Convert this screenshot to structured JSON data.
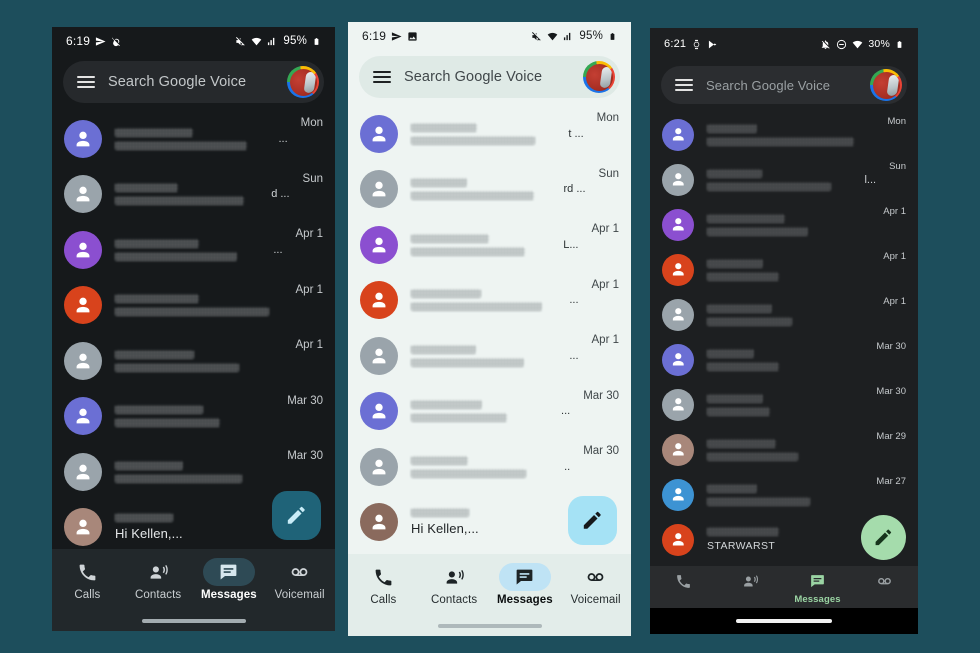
{
  "page": {
    "background_color": "#1d4e5c"
  },
  "phones": [
    {
      "id": "dark1",
      "theme": "dark",
      "status": {
        "time": "6:19",
        "battery": "95%",
        "left_icons": [
          "send-icon",
          "vibrate-off-icon"
        ],
        "right_icons": [
          "mute-icon",
          "wifi-icon",
          "signal-icon"
        ]
      },
      "search": {
        "placeholder": "Search Google Voice",
        "menu_icon": "hamburger-icon",
        "account_icon": "account-avatar-icon"
      },
      "fab": {
        "icon": "compose-pencil-icon",
        "color": "#1f6378"
      },
      "rows": [
        {
          "time": "Mon",
          "avatar_color": "#6b6fd4",
          "title_w": 52,
          "sub_w": 88,
          "tail": "..."
        },
        {
          "time": "Sun",
          "avatar_color": "#9aa4ab",
          "title_w": 44,
          "sub_w": 90,
          "tail": "d ..."
        },
        {
          "time": "Apr 1",
          "avatar_color": "#8b4fd0",
          "title_w": 58,
          "sub_w": 84,
          "tail": "..."
        },
        {
          "time": "Apr 1",
          "avatar_color": "#d8431c",
          "title_w": 50,
          "sub_w": 92,
          "tail": ""
        },
        {
          "time": "Apr 1",
          "avatar_color": "#9aa4ab",
          "title_w": 47,
          "sub_w": 74,
          "tail": ""
        },
        {
          "time": "Mar 30",
          "avatar_color": "#6b6fd4",
          "title_w": 55,
          "sub_w": 66,
          "tail": ""
        },
        {
          "time": "Mar 30",
          "avatar_color": "#9aa4ab",
          "title_w": 43,
          "sub_w": 80,
          "tail": ""
        },
        {
          "time": "",
          "avatar_color": "#a8877a",
          "title_w": 28,
          "sub_text": "Hi Kellen,...",
          "tail": ""
        }
      ],
      "nav": [
        {
          "label": "Calls",
          "icon": "phone-icon",
          "active": false
        },
        {
          "label": "Contacts",
          "icon": "contacts-icon",
          "active": false
        },
        {
          "label": "Messages",
          "icon": "messages-icon",
          "active": true
        },
        {
          "label": "Voicemail",
          "icon": "voicemail-icon",
          "active": false
        }
      ]
    },
    {
      "id": "light",
      "theme": "light",
      "status": {
        "time": "6:19",
        "battery": "95%",
        "left_icons": [
          "send-icon",
          "photo-icon"
        ],
        "right_icons": [
          "mute-icon",
          "wifi-icon",
          "signal-icon"
        ]
      },
      "search": {
        "placeholder": "Search Google Voice",
        "menu_icon": "hamburger-icon",
        "account_icon": "account-avatar-icon"
      },
      "fab": {
        "icon": "compose-pencil-icon",
        "color": "#a5e2f5"
      },
      "rows": [
        {
          "time": "Mon",
          "avatar_color": "#6b6fd4",
          "title_w": 46,
          "sub_w": 86,
          "tail": "t ..."
        },
        {
          "time": "Sun",
          "avatar_color": "#9aa4ab",
          "title_w": 40,
          "sub_w": 88,
          "tail": "rd ..."
        },
        {
          "time": "Apr 1",
          "avatar_color": "#8b4fd0",
          "title_w": 56,
          "sub_w": 82,
          "tail": "L..."
        },
        {
          "time": "Apr 1",
          "avatar_color": "#d8431c",
          "title_w": 48,
          "sub_w": 90,
          "tail": "..."
        },
        {
          "time": "Apr 1",
          "avatar_color": "#9aa4ab",
          "title_w": 45,
          "sub_w": 78,
          "tail": "..."
        },
        {
          "time": "Mar 30",
          "avatar_color": "#6b6fd4",
          "title_w": 52,
          "sub_w": 70,
          "tail": "..."
        },
        {
          "time": "Mar 30",
          "avatar_color": "#9aa4ab",
          "title_w": 41,
          "sub_w": 82,
          "tail": ".."
        },
        {
          "time": "",
          "avatar_color": "#8a6a5d",
          "title_w": 28,
          "sub_text": "Hi Kellen,...",
          "tail": ""
        }
      ],
      "nav": [
        {
          "label": "Calls",
          "icon": "phone-icon",
          "active": false
        },
        {
          "label": "Contacts",
          "icon": "contacts-icon",
          "active": false
        },
        {
          "label": "Messages",
          "icon": "messages-icon",
          "active": true
        },
        {
          "label": "Voicemail",
          "icon": "voicemail-icon",
          "active": false
        }
      ]
    },
    {
      "id": "dark2",
      "theme": "dark",
      "status": {
        "time": "6:21",
        "battery": "30%",
        "left_icons": [
          "watch-icon",
          "play-icon"
        ],
        "right_icons": [
          "notifications-off-icon",
          "dnd-icon",
          "wifi-icon"
        ]
      },
      "search": {
        "placeholder": "Search Google Voice",
        "menu_icon": "hamburger-icon",
        "account_icon": "account-avatar-icon"
      },
      "fab": {
        "icon": "compose-pencil-icon",
        "color": "#a5dcac"
      },
      "rows": [
        {
          "time": "Mon",
          "avatar_color": "#6b6fd4",
          "title_w": 30,
          "sub_w": 88,
          "tail": ""
        },
        {
          "time": "Sun",
          "avatar_color": "#9aa4ab",
          "title_w": 38,
          "sub_w": 86,
          "tail": "l..."
        },
        {
          "time": "Apr 1",
          "avatar_color": "#8b4fd0",
          "title_w": 48,
          "sub_w": 62,
          "tail": ""
        },
        {
          "time": "Apr 1",
          "avatar_color": "#d8431c",
          "title_w": 34,
          "sub_w": 44,
          "tail": ""
        },
        {
          "time": "Apr 1",
          "avatar_color": "#9aa4ab",
          "title_w": 40,
          "sub_w": 52,
          "tail": ""
        },
        {
          "time": "Mar 30",
          "avatar_color": "#6b6fd4",
          "title_w": 30,
          "sub_w": 46,
          "tail": ""
        },
        {
          "time": "Mar 30",
          "avatar_color": "#9aa4ab",
          "title_w": 36,
          "sub_w": 40,
          "tail": ""
        },
        {
          "time": "Mar 29",
          "avatar_color": "#a8877a",
          "title_w": 44,
          "sub_w": 58,
          "tail": ""
        },
        {
          "time": "Mar 27",
          "avatar_color": "#3d93d3",
          "title_w": 32,
          "sub_w": 66,
          "tail": ""
        },
        {
          "time": "",
          "avatar_color": "#d8431c",
          "title_w": 36,
          "sub_text": "STARWARST",
          "tail": ""
        }
      ],
      "nav": [
        {
          "label": "Calls",
          "icon": "phone-icon",
          "active": false
        },
        {
          "label": "Contacts",
          "icon": "contacts-icon",
          "active": false
        },
        {
          "label": "Messages",
          "icon": "messages-icon",
          "active": true
        },
        {
          "label": "Voicemail",
          "icon": "voicemail-icon",
          "active": false
        }
      ]
    }
  ]
}
